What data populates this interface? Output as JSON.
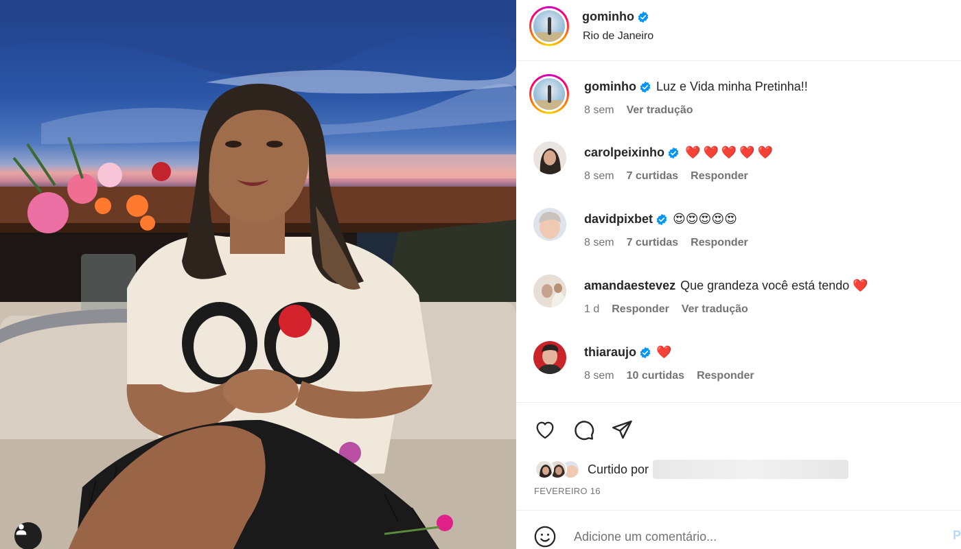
{
  "post": {
    "username": "gominho",
    "location": "Rio de Janeiro",
    "caption": "Luz e Vida minha Pretinha!!",
    "caption_age": "8 sem",
    "translate_label": "Ver tradução",
    "liked_by_label": "Curtido por",
    "date_label": "FEVEREIRO 16"
  },
  "comments": [
    {
      "username": "carolpeixinho",
      "verified": true,
      "text": "❤️❤️❤️❤️❤️",
      "age": "8 sem",
      "likes": "7 curtidas",
      "reply": "Responder"
    },
    {
      "username": "davidpixbet",
      "verified": true,
      "text": "😍😍😍😍😍",
      "age": "8 sem",
      "likes": "7 curtidas",
      "reply": "Responder"
    },
    {
      "username": "amandaestevez",
      "verified": false,
      "text": "Que grandeza você está tendo ❤️",
      "age": "1 d",
      "reply": "Responder",
      "translate": "Ver tradução"
    },
    {
      "username": "thiaraujo",
      "verified": true,
      "text": "❤️",
      "age": "8 sem",
      "likes": "10 curtidas",
      "reply": "Responder"
    }
  ],
  "composer": {
    "placeholder": "Adicione um comentário...",
    "post_label": "P"
  },
  "colors": {
    "verified": "#0095f6",
    "heart": "#ff3040",
    "muted_text": "#737373"
  },
  "icons": [
    "heart-icon",
    "comment-icon",
    "share-icon",
    "emoji-icon",
    "verified-badge-icon",
    "user-tag-icon"
  ]
}
